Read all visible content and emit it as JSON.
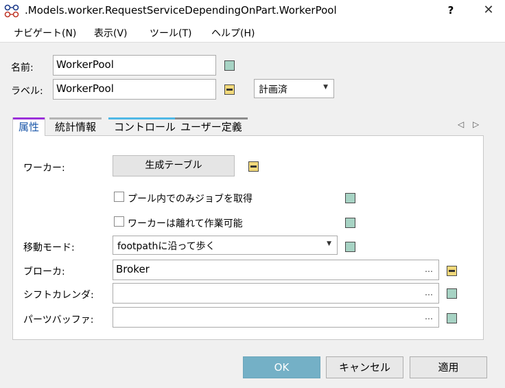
{
  "window": {
    "title": ".Models.worker.RequestServiceDependingOnPart.WorkerPool",
    "help": "?",
    "close": "✕"
  },
  "menu": [
    "ナビゲート(N)",
    "表示(V)",
    "ツール(T)",
    "ヘルプ(H)"
  ],
  "name_field": {
    "label": "名前:",
    "value": "WorkerPool"
  },
  "label_field": {
    "label": "ラベル:",
    "value": "WorkerPool",
    "status": "計画済"
  },
  "tabs": [
    "属性",
    "統計情報",
    "コントロール",
    "ユーザー定義"
  ],
  "tab_colors": [
    "#9b30d9",
    "#b4b4b4",
    "#4fb8e6",
    "#8c8c8c"
  ],
  "props": {
    "worker_label": "ワーカー:",
    "worker_button": "生成テーブル",
    "check1": "プール内でのみジョブを取得",
    "check2": "ワーカーは離れて作業可能",
    "move_mode_label": "移動モード:",
    "move_mode_value": "footpathに沿って歩く",
    "broker_label": "ブローカ:",
    "broker_value": "Broker",
    "shift_label": "シフトカレンダ:",
    "shift_value": "",
    "buffer_label": "パーツバッファ:",
    "buffer_value": "",
    "ellipsis": "…"
  },
  "buttons": {
    "ok": "OK",
    "cancel": "キャンセル",
    "apply": "適用"
  },
  "icons": {
    "dropdown": "▼",
    "prev": "◁",
    "next": "▷"
  },
  "colors": {
    "accent": "#74b0c6",
    "green_marker": "#a7d3c4",
    "yellow_marker": "#f2d97a"
  }
}
